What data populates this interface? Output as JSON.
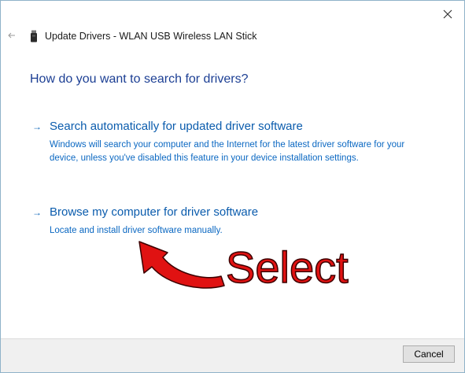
{
  "window": {
    "title": "Update Drivers - WLAN USB Wireless LAN Stick",
    "close_icon": "close-icon",
    "back_icon": "back-arrow-icon",
    "device_icon": "usb-stick-icon"
  },
  "heading": "How do you want to search for drivers?",
  "options": [
    {
      "title": "Search automatically for updated driver software",
      "description": "Windows will search your computer and the Internet for the latest driver software for your device, unless you've disabled this feature in your device installation settings.",
      "icon": "arrow-right-icon"
    },
    {
      "title": "Browse my computer for driver software",
      "description": "Locate and install driver software manually.",
      "icon": "arrow-right-icon"
    }
  ],
  "annotation": {
    "text": "Select",
    "color": "#e01212",
    "icon": "curved-arrow-icon"
  },
  "footer": {
    "cancel_label": "Cancel"
  },
  "colors": {
    "link": "#0b5cad",
    "heading": "#1c3f94",
    "footer_bg": "#f0f0f0"
  }
}
